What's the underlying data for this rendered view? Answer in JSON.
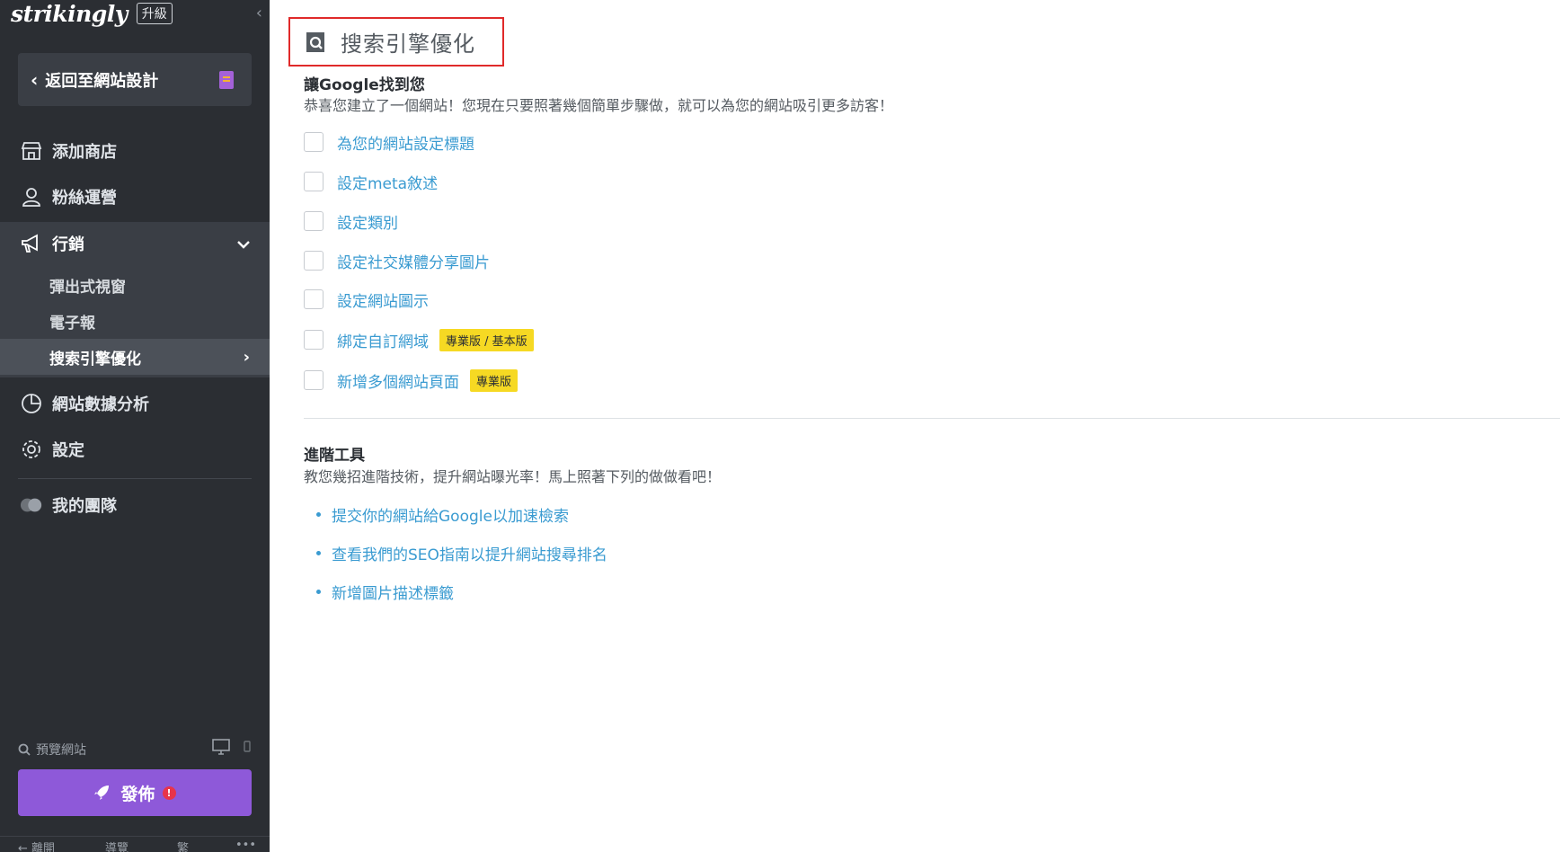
{
  "sidebar": {
    "logo": "strikingly",
    "upgrade": "升級",
    "back_label": "返回至網站設計",
    "items": {
      "store": "添加商店",
      "fans": "粉絲運營",
      "marketing": "行銷",
      "analytics": "網站數據分析",
      "settings": "設定",
      "team": "我的團隊"
    },
    "marketing_sub": {
      "popup": "彈出式視窗",
      "newsletter": "電子報",
      "seo": "搜索引擎優化"
    },
    "preview": "預覽網站",
    "publish": "發佈",
    "publish_alert": "!",
    "bottom": {
      "exit": "離開",
      "guide": "導覽",
      "lang": "繁",
      "more": "•••"
    }
  },
  "main": {
    "page_title": "搜索引擎優化",
    "google": {
      "title": "讓Google找到您",
      "desc": "恭喜您建立了一個網站！您現在只要照著幾個簡單步驟做，就可以為您的網站吸引更多訪客！"
    },
    "checklist": [
      {
        "label": "為您的網站設定標題"
      },
      {
        "label": "設定meta敘述"
      },
      {
        "label": "設定類別"
      },
      {
        "label": "設定社交媒體分享圖片"
      },
      {
        "label": "設定網站圖示"
      },
      {
        "label": "綁定自訂網域",
        "tag": "專業版 / 基本版"
      },
      {
        "label": "新增多個網站頁面",
        "tag": "專業版"
      }
    ],
    "advanced": {
      "title": "進階工具",
      "desc": "教您幾招進階技術，提升網站曝光率！馬上照著下列的做做看吧！",
      "links": [
        "提交你的網站給Google以加速檢索",
        "查看我們的SEO指南以提升網站搜尋排名",
        "新增圖片描述標籤"
      ]
    }
  },
  "colors": {
    "sidebar": "#2b2e33",
    "accent": "#3a9bd1",
    "publish": "#8e59d9",
    "tag": "#f6d923",
    "highlight": "#e02a2a"
  }
}
